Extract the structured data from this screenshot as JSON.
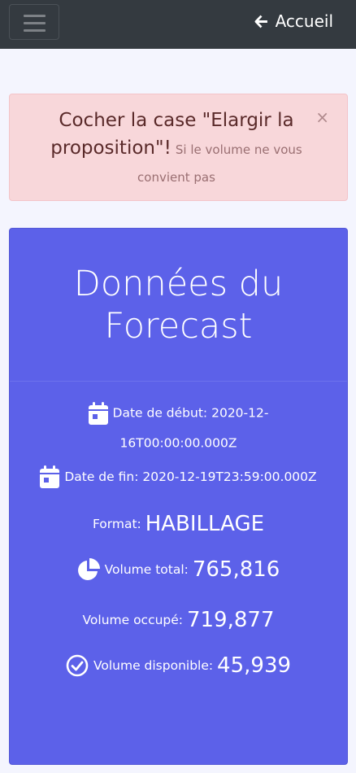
{
  "navbar": {
    "home_label": "Accueil"
  },
  "alert": {
    "strong_text": "Cocher la case \"Elargir la proposition\"!",
    "small_text": "Si le volume ne vous convient pas",
    "close_symbol": "×"
  },
  "card": {
    "title": "Données du Forecast",
    "start_date_label": "Date de début:",
    "start_date_value": "2020-12-16T00:00:00.000Z",
    "end_date_label": "Date de fin:",
    "end_date_value": "2020-12-19T23:59:00.000Z",
    "format_label": "Format:",
    "format_value": "HABILLAGE",
    "volume_total_label": "Volume total:",
    "volume_total_value": "765,816",
    "volume_occupied_label": "Volume occupé:",
    "volume_occupied_value": "719,877",
    "volume_available_label": "Volume disponible:",
    "volume_available_value": "45,939"
  },
  "colors": {
    "navbar": "#343a40",
    "card": "#5c61e9",
    "alert_bg": "#f8d7da"
  }
}
